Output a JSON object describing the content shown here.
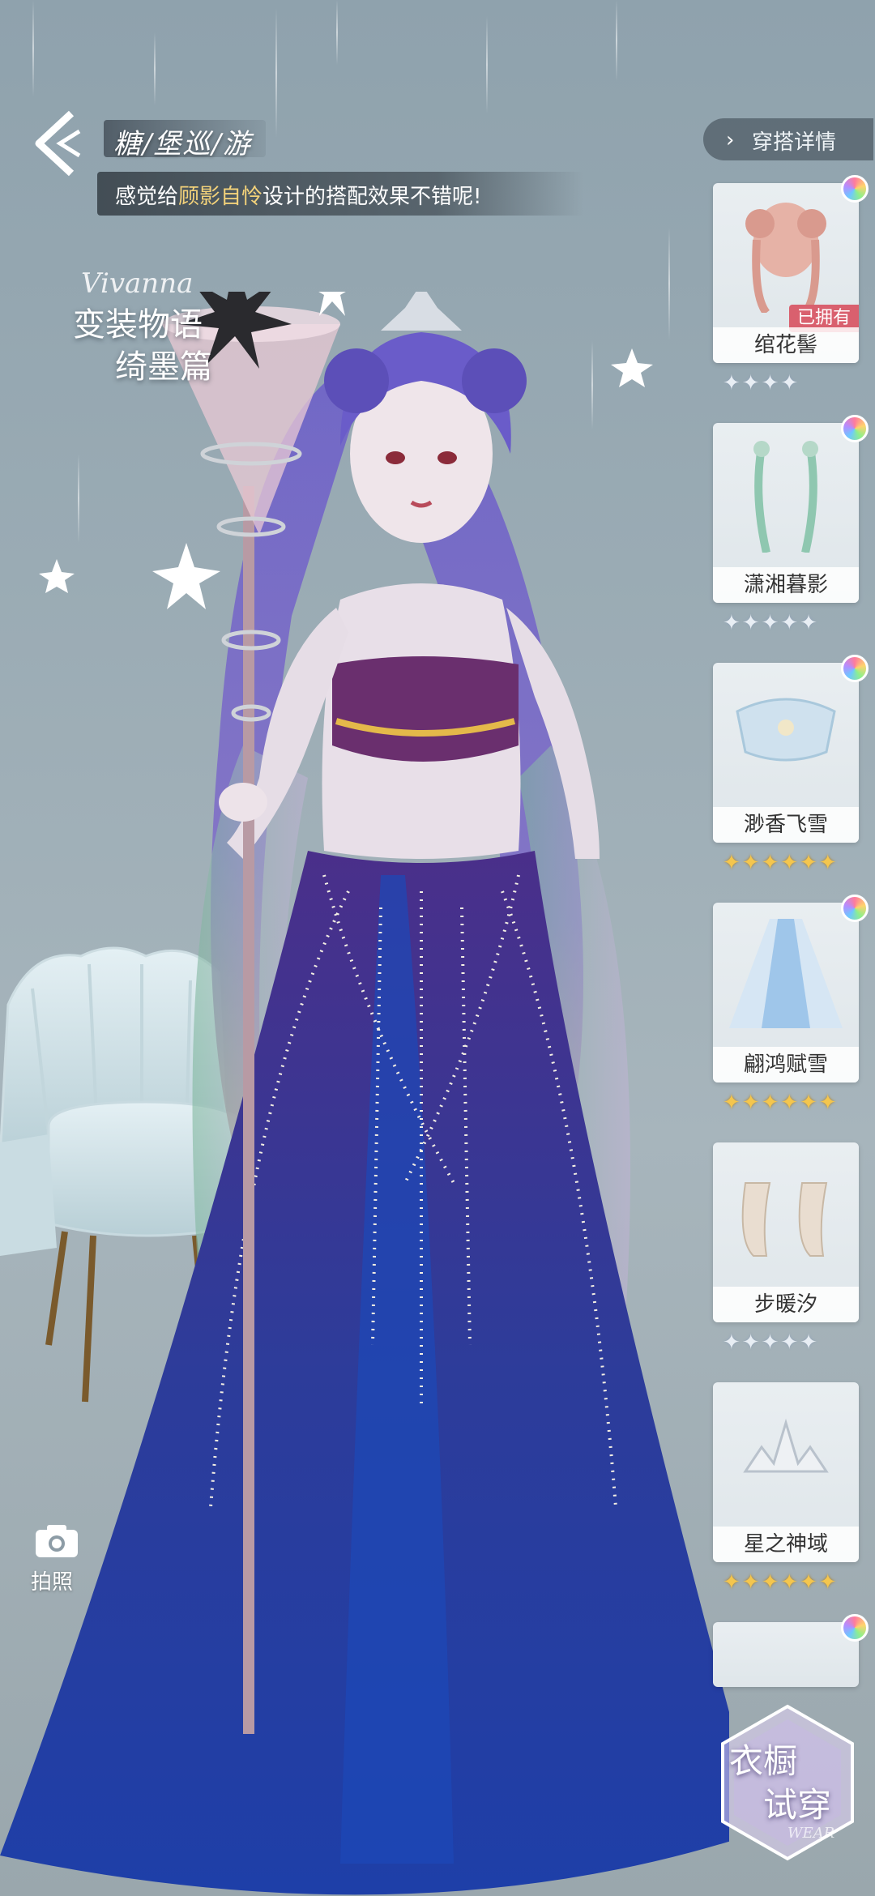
{
  "header": {
    "title": "糖/堡巡/游",
    "message_prefix": "感觉给",
    "message_name": "顾影自怜",
    "message_suffix": "设计的搭配效果不错呢!"
  },
  "details_button": {
    "label": "穿搭详情"
  },
  "event_logo": {
    "signature": "Vivanna",
    "line1": "变装物语",
    "line2": "绮墨篇"
  },
  "camera": {
    "label": "拍照",
    "icon": "camera-icon"
  },
  "items": [
    {
      "name": "绾花髻",
      "owned_label": "已拥有",
      "star_count": 4,
      "star_type": "silver"
    },
    {
      "name": "潇湘暮影",
      "owned_label": "",
      "star_count": 5,
      "star_type": "silver"
    },
    {
      "name": "渺香飞雪",
      "owned_label": "",
      "star_count": 6,
      "star_type": "gold"
    },
    {
      "name": "翩鸿赋雪",
      "owned_label": "",
      "star_count": 6,
      "star_type": "gold"
    },
    {
      "name": "步暖汐",
      "owned_label": "",
      "star_count": 5,
      "star_type": "silver"
    },
    {
      "name": "星之神域",
      "owned_label": "",
      "star_count": 6,
      "star_type": "gold"
    }
  ],
  "wardrobe": {
    "line1": "衣橱",
    "line2": "试穿",
    "sub": "WEAR"
  },
  "colors": {
    "accent_highlight": "#f3d27a",
    "owned_badge": "#d9606e",
    "gold_star": "#f4c64e"
  }
}
